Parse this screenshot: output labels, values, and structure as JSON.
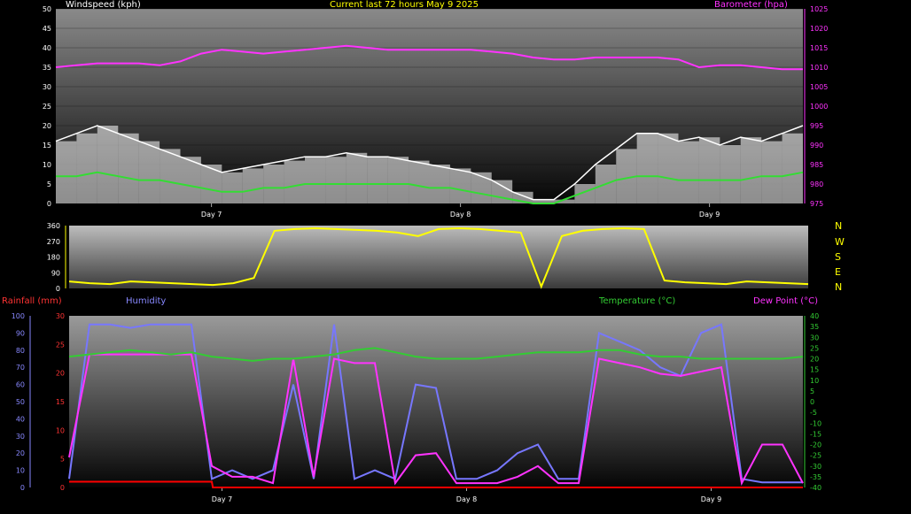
{
  "colors": {
    "wind": "#ffffff",
    "gust": "#ffffff",
    "wind_avg": "#33dd33",
    "barometer": "#ff33ff",
    "direction": "#ffff00",
    "rainfall": "#ff0000",
    "humidity": "#7777ff",
    "temperature": "#33cc33",
    "dewpoint": "#ff33ff",
    "tick_left": "#ff3333",
    "tick_hum": "#8888ff",
    "tick_temp": "#33cc33"
  },
  "chart_data": [
    {
      "type": "line",
      "title": "Current last 72 hours May 9 2025",
      "ylabel": "Windspeed (kph)",
      "y2label": "Barometer (hpa)",
      "ylim": [
        0,
        50
      ],
      "y2lim": [
        975,
        1025
      ],
      "yticks": [
        "0",
        "5",
        "10",
        "15",
        "20",
        "25",
        "30",
        "35",
        "40",
        "45",
        "50"
      ],
      "y2ticks": [
        "975",
        "980",
        "985",
        "990",
        "995",
        "1000",
        "1005",
        "1010",
        "1015",
        "1020",
        "1025"
      ],
      "x_labels": [
        "Day 7",
        "Day 8",
        "Day 9"
      ],
      "x_label_hours": [
        9,
        33,
        57
      ],
      "x_range_hours": [
        -6,
        66
      ],
      "series": [
        {
          "key": "gust",
          "hours": [
            -6,
            -4,
            -2,
            0,
            2,
            4,
            6,
            8,
            10,
            12,
            14,
            16,
            18,
            20,
            22,
            24,
            26,
            28,
            30,
            32,
            34,
            36,
            38,
            40,
            42,
            44,
            46,
            48,
            50,
            52,
            54,
            56,
            58,
            60,
            62,
            64,
            66
          ],
          "values": [
            16,
            18,
            20,
            18,
            16,
            14,
            12,
            10,
            8,
            9,
            10,
            11,
            12,
            12,
            13,
            12,
            12,
            11,
            10,
            9,
            8,
            6,
            3,
            1,
            1,
            5,
            10,
            14,
            18,
            18,
            16,
            17,
            15,
            17,
            16,
            18,
            20
          ]
        },
        {
          "key": "wind_avg",
          "hours": [
            -6,
            -4,
            -2,
            0,
            2,
            4,
            6,
            8,
            10,
            12,
            14,
            16,
            18,
            20,
            22,
            24,
            26,
            28,
            30,
            32,
            34,
            36,
            38,
            40,
            42,
            44,
            46,
            48,
            50,
            52,
            54,
            56,
            58,
            60,
            62,
            64,
            66
          ],
          "values": [
            7,
            7,
            8,
            7,
            6,
            6,
            5,
            4,
            3,
            3,
            4,
            4,
            5,
            5,
            5,
            5,
            5,
            5,
            4,
            4,
            3,
            2,
            1,
            0,
            0,
            2,
            4,
            6,
            7,
            7,
            6,
            6,
            6,
            6,
            7,
            7,
            8
          ]
        },
        {
          "key": "barometer",
          "hours": [
            -6,
            -4,
            -2,
            0,
            2,
            4,
            6,
            8,
            10,
            12,
            14,
            16,
            18,
            20,
            22,
            24,
            26,
            28,
            30,
            32,
            34,
            36,
            38,
            40,
            42,
            44,
            46,
            48,
            50,
            52,
            54,
            56,
            58,
            60,
            62,
            64,
            66
          ],
          "values": [
            1010,
            1010.5,
            1011,
            1011,
            1011,
            1010.5,
            1011.5,
            1013.5,
            1014.5,
            1014,
            1013.5,
            1014,
            1014.5,
            1015,
            1015.5,
            1015,
            1014.5,
            1014.5,
            1014.5,
            1014.5,
            1014.5,
            1014,
            1013.5,
            1012.5,
            1012,
            1012,
            1012.5,
            1012.5,
            1012.5,
            1012.5,
            1012,
            1010,
            1010.5,
            1010.5,
            1010,
            1009.5,
            1009.5
          ]
        }
      ]
    },
    {
      "type": "line",
      "ylabel": "",
      "ylim": [
        0,
        360
      ],
      "yticks": [
        "0",
        "90",
        "180",
        "270",
        "360"
      ],
      "compass": [
        "N",
        "W",
        "S",
        "E",
        "N"
      ],
      "series": [
        {
          "key": "direction",
          "hours": [
            -6,
            -4,
            -2,
            0,
            2,
            4,
            6,
            8,
            10,
            12,
            14,
            16,
            18,
            20,
            22,
            24,
            26,
            28,
            30,
            32,
            34,
            36,
            38,
            40,
            42,
            44,
            46,
            48,
            50,
            52,
            54,
            56,
            58,
            60,
            62,
            64,
            66
          ],
          "values": [
            40,
            30,
            25,
            40,
            35,
            30,
            25,
            20,
            30,
            60,
            330,
            340,
            345,
            340,
            335,
            330,
            320,
            300,
            340,
            345,
            340,
            330,
            320,
            10,
            300,
            330,
            340,
            345,
            340,
            45,
            35,
            30,
            25,
            40,
            35,
            30,
            25
          ]
        }
      ]
    },
    {
      "type": "line",
      "ylabel_left": "Rainfall (mm)",
      "ylabel_hum": "Humidity",
      "ylabel_temp": "Temperature (°C)",
      "ylabel_dew": "Dew Point (°C)",
      "rain_lim": [
        0,
        30
      ],
      "rain_ticks": [
        "0",
        "5",
        "10",
        "15",
        "20",
        "25",
        "30"
      ],
      "hum_lim": [
        0,
        100
      ],
      "hum_ticks": [
        "0",
        "10",
        "20",
        "30",
        "40",
        "50",
        "60",
        "70",
        "80",
        "90",
        "100"
      ],
      "temp_lim": [
        -40,
        40
      ],
      "temp_ticks": [
        "-40",
        "-35",
        "-30",
        "-25",
        "-20",
        "-15",
        "-10",
        "-5",
        "0",
        "5",
        "10",
        "15",
        "20",
        "25",
        "30",
        "35",
        "40"
      ],
      "series": [
        {
          "key": "humidity",
          "hours": [
            -6,
            -4,
            -2,
            0,
            2,
            4,
            6,
            8,
            10,
            12,
            14,
            16,
            18,
            20,
            22,
            24,
            26,
            28,
            30,
            32,
            34,
            36,
            38,
            40,
            42,
            44,
            46,
            48,
            50,
            52,
            54,
            56,
            58,
            60,
            62,
            64,
            66
          ],
          "values": [
            5,
            95,
            95,
            93,
            95,
            95,
            95,
            5,
            10,
            5,
            10,
            60,
            5,
            95,
            5,
            10,
            5,
            60,
            58,
            5,
            5,
            10,
            20,
            25,
            5,
            5,
            90,
            85,
            80,
            70,
            65,
            90,
            95,
            5,
            3,
            3,
            3
          ]
        },
        {
          "key": "temperature",
          "hours": [
            -6,
            -4,
            -2,
            0,
            2,
            4,
            6,
            8,
            10,
            12,
            14,
            16,
            18,
            20,
            22,
            24,
            26,
            28,
            30,
            32,
            34,
            36,
            38,
            40,
            42,
            44,
            46,
            48,
            50,
            52,
            54,
            56,
            58,
            60,
            62,
            64,
            66
          ],
          "values": [
            21,
            22,
            23,
            24,
            23,
            22,
            23,
            21,
            20,
            19,
            20,
            20,
            21,
            22,
            24,
            25,
            23,
            21,
            20,
            20,
            20,
            21,
            22,
            23,
            23,
            23,
            24,
            24,
            22,
            21,
            21,
            20,
            20,
            20,
            20,
            20,
            21
          ]
        },
        {
          "key": "dewpoint",
          "hours": [
            -6,
            -4,
            -2,
            0,
            2,
            4,
            6,
            8,
            10,
            12,
            14,
            16,
            18,
            20,
            22,
            24,
            26,
            28,
            30,
            32,
            34,
            36,
            38,
            40,
            42,
            44,
            46,
            48,
            50,
            52,
            54,
            56,
            58,
            60,
            62,
            64,
            66
          ],
          "values": [
            -26,
            22,
            22,
            22,
            22,
            22,
            22,
            -30,
            -35,
            -35,
            -38,
            20,
            -35,
            20,
            18,
            18,
            -38,
            -25,
            -24,
            -38,
            -38,
            -38,
            -35,
            -30,
            -38,
            -38,
            20,
            18,
            16,
            13,
            12,
            14,
            16,
            -38,
            -20,
            -20,
            -38
          ]
        },
        {
          "key": "rainfall",
          "hours": [
            -6,
            -4,
            -2,
            0,
            2,
            4,
            6,
            8,
            8.1,
            10,
            12,
            14,
            16,
            18,
            20,
            22,
            24,
            26,
            28,
            30,
            32,
            34,
            36,
            38,
            40,
            42,
            44,
            46,
            48,
            50,
            52,
            54,
            56,
            58,
            60,
            62,
            64,
            66
          ],
          "values": [
            1,
            1,
            1,
            1,
            1,
            1,
            1,
            1,
            0,
            0,
            0,
            0,
            0,
            0,
            0,
            0,
            0,
            0,
            0,
            0,
            0,
            0,
            0,
            0,
            0,
            0,
            0,
            0,
            0,
            0,
            0,
            0,
            0,
            0,
            0,
            0,
            0,
            0
          ]
        }
      ]
    }
  ]
}
